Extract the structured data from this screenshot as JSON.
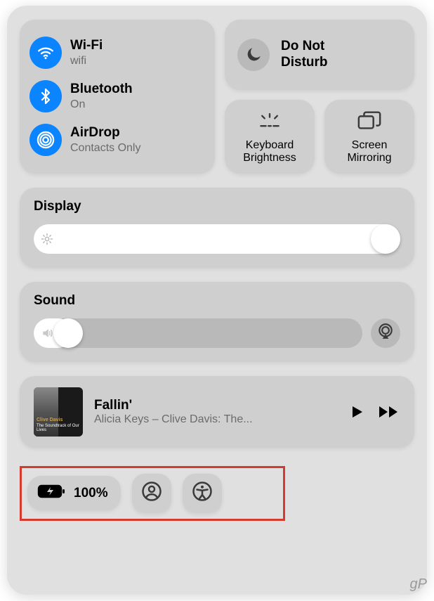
{
  "connectivity": {
    "wifi": {
      "title": "Wi-Fi",
      "sub": "wifi"
    },
    "bluetooth": {
      "title": "Bluetooth",
      "sub": "On"
    },
    "airdrop": {
      "title": "AirDrop",
      "sub": "Contacts Only"
    }
  },
  "dnd": {
    "title": "Do Not\nDisturb"
  },
  "keyboard_brightness": {
    "label": "Keyboard\nBrightness"
  },
  "screen_mirroring": {
    "label": "Screen\nMirroring"
  },
  "display": {
    "title": "Display",
    "value_pct": 98
  },
  "sound": {
    "title": "Sound",
    "value_pct": 10
  },
  "media": {
    "album_line1": "Clive Davis",
    "album_line2": "The Soundtrack of Our Lives",
    "title": "Fallin'",
    "subtitle": "Alicia Keys – Clive Davis: The..."
  },
  "battery": {
    "label": "100%"
  },
  "watermark": "gP"
}
